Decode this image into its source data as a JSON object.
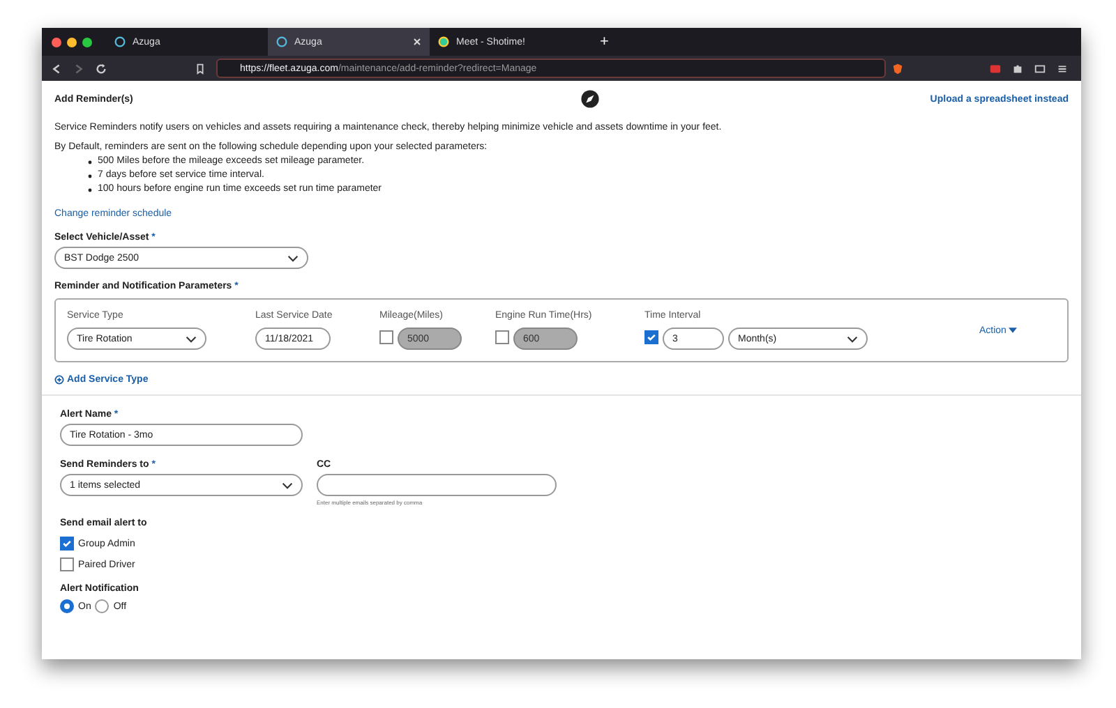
{
  "browser": {
    "tabs": [
      {
        "label": "Azuga",
        "selected": false
      },
      {
        "label": "Azuga",
        "selected": true
      },
      {
        "label": "Meet - Shotime!",
        "selected": false
      }
    ],
    "new_tab": "+",
    "url_host": "https://fleet.azuga.com",
    "url_path": "/maintenance/add-reminder?redirect=Manage"
  },
  "header": {
    "title": "Add Reminder(s)",
    "upload_link": "Upload a spreadsheet instead"
  },
  "intro": "Service Reminders notify users on vehicles and assets requiring a maintenance check, thereby helping minimize vehicle and assets downtime in your feet.",
  "schedule_intro": "By Default, reminders are sent on the following schedule depending upon your selected parameters:",
  "schedule": [
    "500 Miles before the mileage exceeds set mileage parameter.",
    "7 days before set service time interval.",
    "100 hours before engine run time exceeds set run time parameter"
  ],
  "change_link": "Change reminder schedule",
  "vehicle": {
    "label": "Select Vehicle/Asset",
    "required": "*",
    "value": "BST Dodge 2500"
  },
  "params": {
    "label": "Reminder and Notification Parameters",
    "required": "*",
    "columns": [
      "Service Type",
      "Last Service Date",
      "Mileage(Miles)",
      "Engine Run Time(Hrs)",
      "Time Interval"
    ],
    "service_type": "Tire Rotation",
    "last_service_date": "11/18/2021",
    "mileage": {
      "checked": false,
      "value": "5000"
    },
    "engine": {
      "checked": false,
      "value": "600"
    },
    "interval": {
      "checked": true,
      "value": "3",
      "unit": "Month(s)"
    },
    "action": "Action"
  },
  "add_service": "Add Service Type",
  "alert_name": {
    "label": "Alert Name",
    "required": "*",
    "value": "Tire Rotation - 3mo"
  },
  "send_to": {
    "label": "Send Reminders to",
    "required": "*",
    "value": "1 items selected"
  },
  "cc": {
    "label": "CC",
    "hint": "Enter multiple emails separated by comma"
  },
  "email_alert": {
    "label": "Send email alert to",
    "options": [
      {
        "label": "Group Admin",
        "checked": true
      },
      {
        "label": "Paired Driver",
        "checked": false
      }
    ]
  },
  "notification": {
    "label": "Alert Notification",
    "options": [
      {
        "label": "On",
        "selected": true
      },
      {
        "label": "Off",
        "selected": false
      }
    ]
  }
}
